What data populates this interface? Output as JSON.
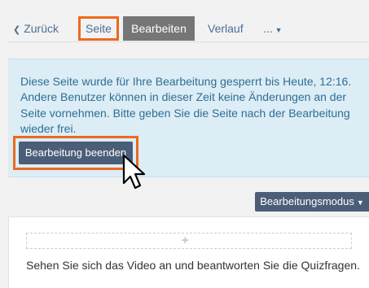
{
  "tabs": {
    "back_label": "Zurück",
    "page_label": "Seite",
    "edit_label": "Bearbeiten",
    "history_label": "Verlauf",
    "more_label": "..."
  },
  "notice": {
    "text": "Diese Seite wurde für Ihre Bearbeitung gesperrt bis Heute, 12:16. Andere Benutzer können in dieser Zeit keine Änderungen an der Seite vornehmen. Bitte geben Sie die Seite nach der Bearbeitung wieder frei.",
    "end_edit_label": "Bearbeitung beenden"
  },
  "mode_button_label": "Bearbeitungsmodus",
  "content": {
    "text": "Sehen Sie sich das Video an und beantworten Sie die Quizfragen."
  },
  "icons": {
    "back": "chevron-left-icon",
    "more": "caret-down-icon",
    "add": "plus-icon",
    "cursor": "mouse-pointer-icon"
  },
  "colors": {
    "highlight": "#ec6a1e",
    "notice_bg": "#dcedf6",
    "notice_text": "#2f6e94",
    "button": "#4b5e78",
    "active_tab": "#767676",
    "link": "#4a6f94"
  }
}
